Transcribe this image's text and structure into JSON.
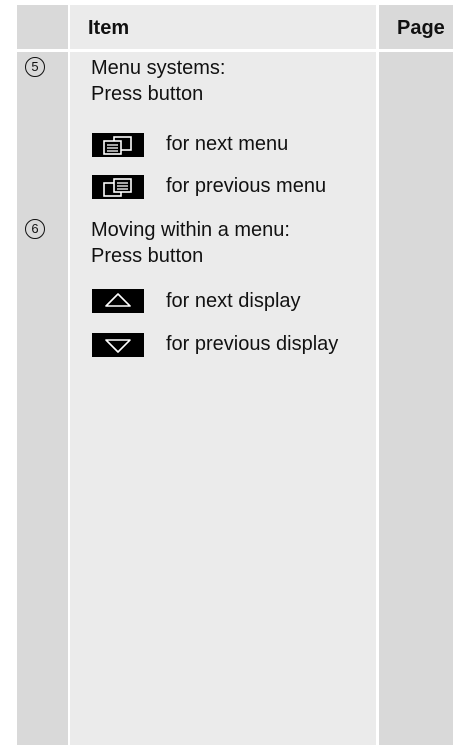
{
  "header": {
    "item": "Item",
    "page": "Page"
  },
  "rows": [
    {
      "number": "5",
      "line1": "Menu systems:",
      "line2": "Press button",
      "buttons": [
        {
          "icon": "next-menu-icon",
          "label": "for next menu"
        },
        {
          "icon": "previous-menu-icon",
          "label": "for previous menu"
        }
      ]
    },
    {
      "number": "6",
      "line1": "Moving within a menu:",
      "line2": "Press button",
      "buttons": [
        {
          "icon": "up-arrow-icon",
          "label": "for next display"
        },
        {
          "icon": "down-arrow-icon",
          "label": "for previous display"
        }
      ]
    }
  ]
}
